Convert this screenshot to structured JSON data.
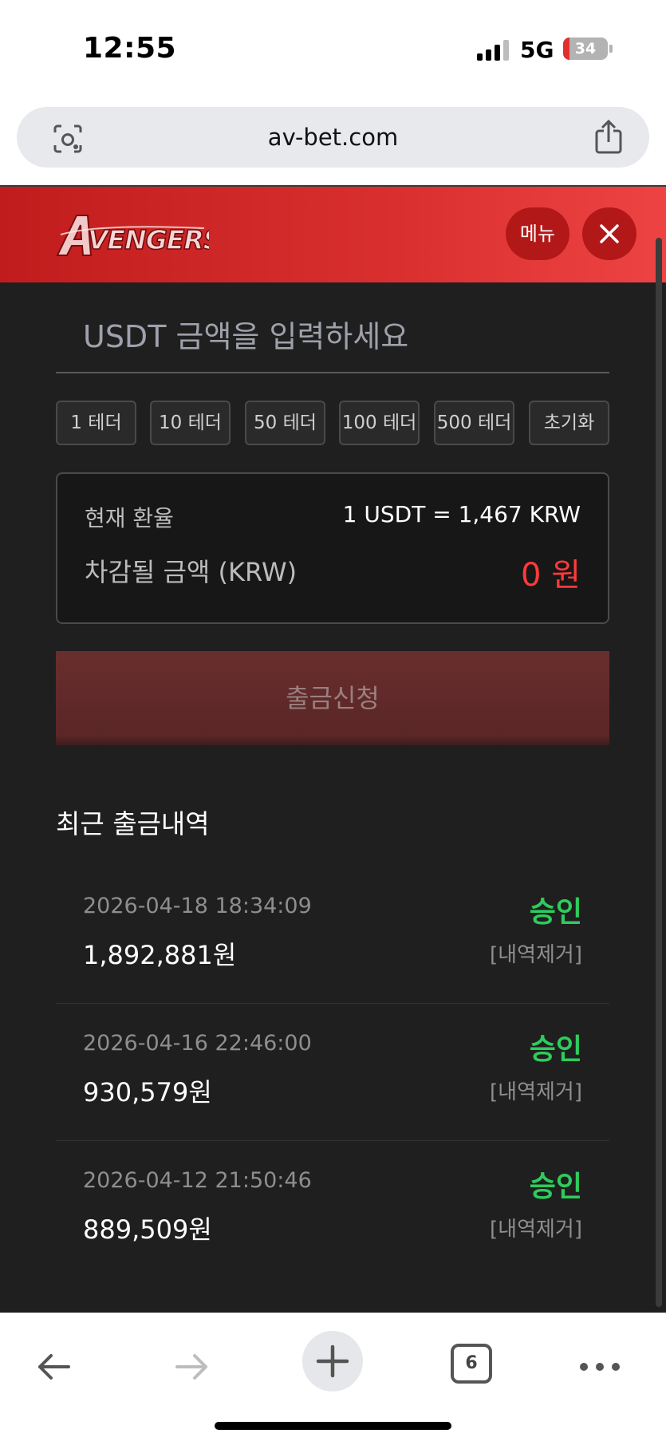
{
  "status_bar": {
    "time": "12:55",
    "network": "5G",
    "battery": "34"
  },
  "browser": {
    "url": "av-bet.com",
    "tab_count": "6"
  },
  "header": {
    "logo_text": "AVENGERS",
    "menu_label": "메뉴"
  },
  "withdraw": {
    "amount_placeholder": "USDT 금액을 입력하세요",
    "presets": [
      "1 테더",
      "10 테더",
      "50 테더",
      "100 테더",
      "500 테더",
      "초기화"
    ],
    "rate_label": "현재 환율",
    "rate_value": "1 USDT = 1,467 KRW",
    "deduct_label": "차감될 금액 (KRW)",
    "deduct_value": "0 원",
    "submit_label": "출금신청"
  },
  "history": {
    "title": "최근 출금내역",
    "items": [
      {
        "date": "2026-04-18 18:34:09",
        "amount": "1,892,881원",
        "status": "승인",
        "remove": "[내역제거]"
      },
      {
        "date": "2026-04-16 22:46:00",
        "amount": "930,579원",
        "status": "승인",
        "remove": "[내역제거]"
      },
      {
        "date": "2026-04-12 21:50:46",
        "amount": "889,509원",
        "status": "승인",
        "remove": "[내역제거]"
      }
    ]
  },
  "colors": {
    "brand_red": "#d9302f",
    "status_green": "#2ecc5c",
    "page_bg": "#1f1f1f",
    "amount_red": "#ff3a3a"
  }
}
